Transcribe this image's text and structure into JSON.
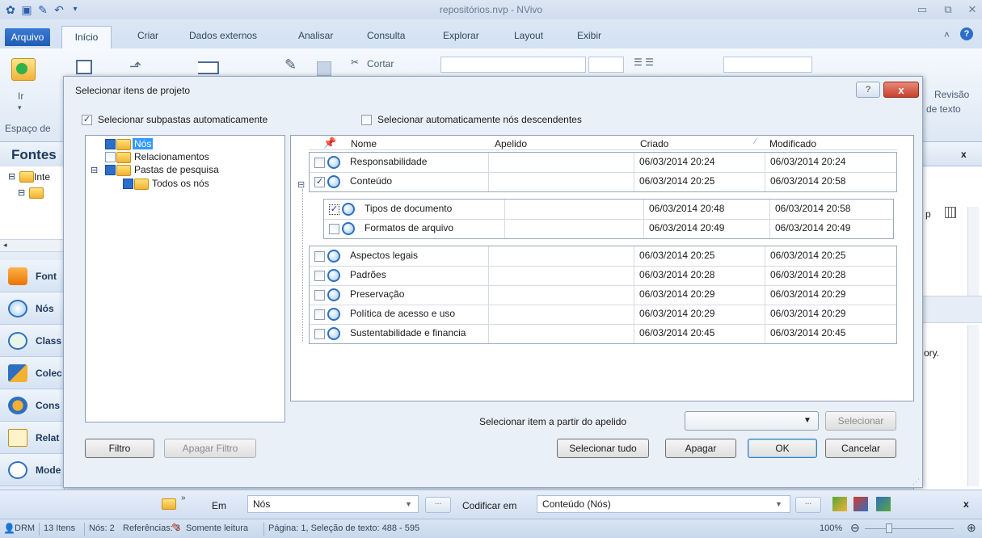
{
  "app": {
    "title": "repositórios.nvp - NVivo"
  },
  "tabs": [
    "Arquivo",
    "Início",
    "Criar",
    "Dados externos",
    "Analisar",
    "Consulta",
    "Explorar",
    "Layout",
    "Exibir"
  ],
  "ribbon": {
    "ir_label": "Ir",
    "workspace_label": "Espaço de",
    "cut_label": "Cortar",
    "review_label": "Revisão",
    "review_label2": "de texto"
  },
  "left": {
    "panel_title": "Fontes",
    "tree_item": "Inte",
    "nav": [
      "Font",
      "Nós",
      "Class",
      "Colec",
      "Cons",
      "Relat",
      "Mode"
    ]
  },
  "right": {
    "close": "x",
    "col_label": "p",
    "text_fragment": "ory."
  },
  "dialog": {
    "title": "Selecionar itens de projeto",
    "help": "?",
    "close": "x",
    "auto_subfolders": "Selecionar subpastas automaticamente",
    "auto_descendants": "Selecionar automaticamente nós descendentes",
    "tree": [
      {
        "label": "Nós",
        "selected": true
      },
      {
        "label": "Relacionamentos"
      },
      {
        "label": "Pastas de pesquisa"
      },
      {
        "label": "Todos os nós"
      }
    ],
    "columns": [
      "Nome",
      "Apelido",
      "Criado",
      "Modificado"
    ],
    "rows": [
      {
        "name": "Responsabilidade",
        "alias": "",
        "created": "06/03/2014 20:24",
        "modified": "06/03/2014 20:24",
        "checked": false
      },
      {
        "name": "Conteúdo",
        "alias": "",
        "created": "06/03/2014 20:25",
        "modified": "06/03/2014 20:58",
        "checked": true
      }
    ],
    "child_rows": [
      {
        "name": "Tipos de documento",
        "alias": "",
        "created": "06/03/2014 20:48",
        "modified": "06/03/2014 20:58",
        "checked": true
      },
      {
        "name": "Formatos de arquivo",
        "alias": "",
        "created": "06/03/2014 20:49",
        "modified": "06/03/2014 20:49",
        "checked": false
      }
    ],
    "rows2": [
      {
        "name": "Aspectos legais",
        "alias": "",
        "created": "06/03/2014 20:25",
        "modified": "06/03/2014 20:25",
        "checked": false
      },
      {
        "name": "Padrões",
        "alias": "",
        "created": "06/03/2014 20:28",
        "modified": "06/03/2014 20:28",
        "checked": false
      },
      {
        "name": "Preservação",
        "alias": "",
        "created": "06/03/2014 20:29",
        "modified": "06/03/2014 20:29",
        "checked": false
      },
      {
        "name": "Política de acesso e uso",
        "alias": "",
        "created": "06/03/2014 20:29",
        "modified": "06/03/2014 20:29",
        "checked": false
      },
      {
        "name": "Sustentabilidade e financia",
        "alias": "",
        "created": "06/03/2014 20:45",
        "modified": "06/03/2014 20:45",
        "checked": false
      }
    ],
    "alias_label": "Selecionar item a partir do apelido",
    "select_btn": "Selecionar",
    "filter_btn": "Filtro",
    "clear_filter_btn": "Apagar Filtro",
    "select_all_btn": "Selecionar tudo",
    "clear_btn": "Apagar",
    "ok_btn": "OK",
    "cancel_btn": "Cancelar"
  },
  "bottom": {
    "in_label": "Em",
    "in_value": "Nós",
    "code_label": "Codificar em",
    "code_value": "Conteúdo (Nós)",
    "ellipsis": "...",
    "close": "x"
  },
  "status": {
    "user": "DRM",
    "items": "13 Itens",
    "nodes": "Nós: 2",
    "refs": "Referências: 3",
    "readonly": "Somente leitura",
    "page": "Página: 1, Seleção de texto: 488 - 595",
    "zoom": "100%"
  }
}
